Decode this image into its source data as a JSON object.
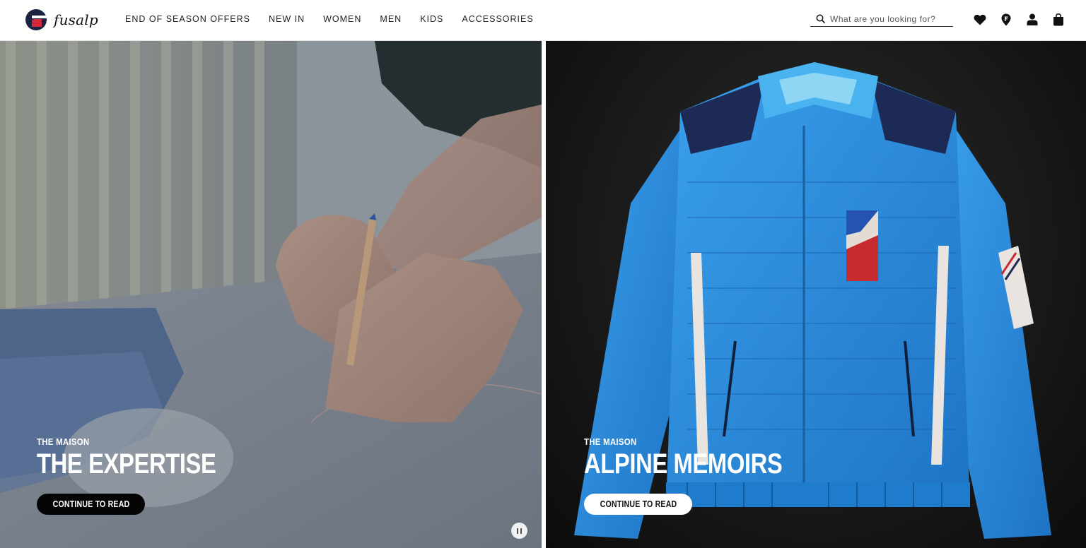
{
  "brand": {
    "name": "fusalp"
  },
  "nav": {
    "items": [
      "END OF SEASON OFFERS",
      "NEW IN",
      "WOMEN",
      "MEN",
      "KIDS",
      "ACCESSORIES"
    ]
  },
  "search": {
    "placeholder": "What are you looking for?"
  },
  "header_icons": [
    "search-icon",
    "heart-icon",
    "store-locator-icon",
    "account-icon",
    "shopping-bag-icon"
  ],
  "panels": [
    {
      "kicker": "THE MAISON",
      "title": "THE EXPERTISE",
      "cta": "CONTINUE TO READ",
      "cta_style": "dark"
    },
    {
      "kicker": "THE MAISON",
      "title": "ALPINE MEMOIRS",
      "cta": "CONTINUE TO READ",
      "cta_style": "light"
    }
  ],
  "colors": {
    "brand_navy": "#1c2340",
    "brand_red": "#d6283a",
    "jacket_blue": "#2d8fdc"
  }
}
